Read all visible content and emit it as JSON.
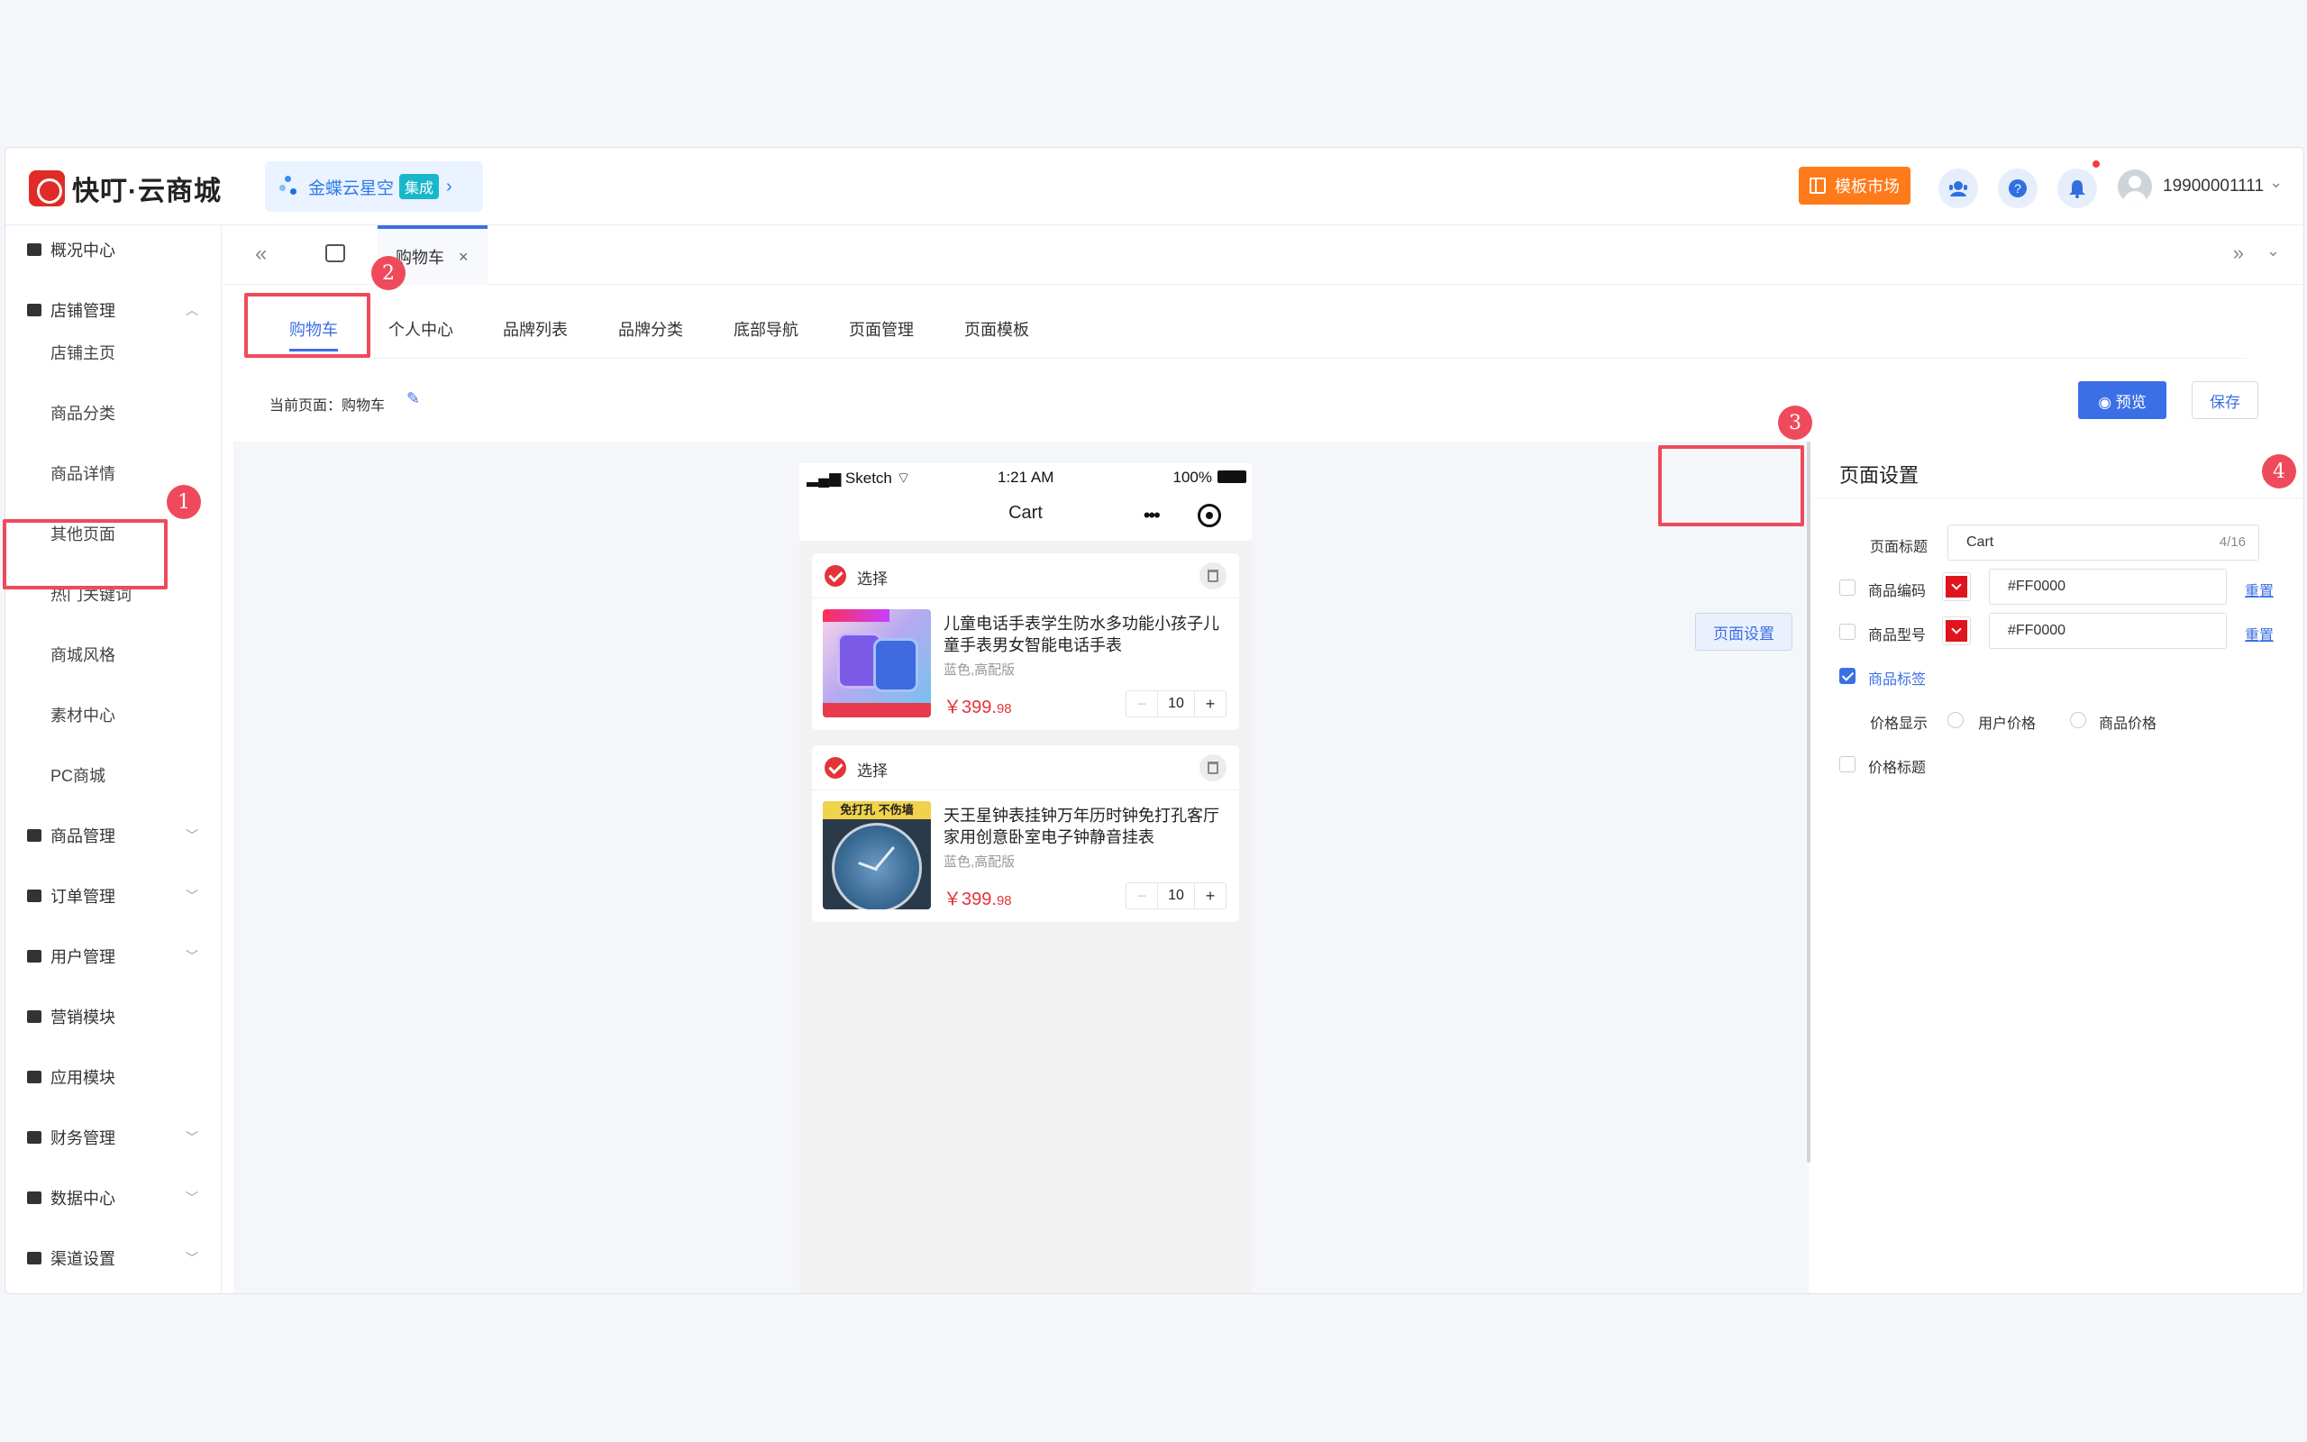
{
  "header": {
    "brand": "快叮·云商城",
    "integration": {
      "name": "金蝶云星空",
      "badge": "集成",
      "chevron": "›"
    },
    "template_market": "模板市场",
    "icons": [
      "customer-service-icon",
      "help-icon",
      "bell-icon"
    ],
    "help_glyph": "?",
    "user_phone": "19900001111",
    "user_chevron": "⌄"
  },
  "sidebar": {
    "items": [
      {
        "label": "概况中心",
        "type": "top",
        "chevron": ""
      },
      {
        "label": "店铺管理",
        "type": "top",
        "chevron": "︿"
      },
      {
        "label": "店铺主页",
        "type": "sub"
      },
      {
        "label": "商品分类",
        "type": "sub"
      },
      {
        "label": "商品详情",
        "type": "sub"
      },
      {
        "label": "其他页面",
        "type": "sub"
      },
      {
        "label": "热门关键词",
        "type": "sub"
      },
      {
        "label": "商城风格",
        "type": "sub"
      },
      {
        "label": "素材中心",
        "type": "sub"
      },
      {
        "label": "PC商城",
        "type": "sub"
      },
      {
        "label": "商品管理",
        "type": "top",
        "chevron": "﹀"
      },
      {
        "label": "订单管理",
        "type": "top",
        "chevron": "﹀"
      },
      {
        "label": "用户管理",
        "type": "top",
        "chevron": "﹀"
      },
      {
        "label": "营销模块",
        "type": "top",
        "chevron": ""
      },
      {
        "label": "应用模块",
        "type": "top",
        "chevron": ""
      },
      {
        "label": "财务管理",
        "type": "top",
        "chevron": "﹀"
      },
      {
        "label": "数据中心",
        "type": "top",
        "chevron": "﹀"
      },
      {
        "label": "渠道设置",
        "type": "top",
        "chevron": "﹀"
      }
    ]
  },
  "tabbar": {
    "collapse_glyph": "«",
    "open_tab": "购物车",
    "close_glyph": "×",
    "right_glyph": "»",
    "dropdown_glyph": "⌄"
  },
  "page_tabs": [
    {
      "label": "购物车",
      "active": true
    },
    {
      "label": "个人中心",
      "active": false
    },
    {
      "label": "品牌列表",
      "active": false
    },
    {
      "label": "品牌分类",
      "active": false
    },
    {
      "label": "底部导航",
      "active": false
    },
    {
      "label": "页面管理",
      "active": false
    },
    {
      "label": "页面模板",
      "active": false
    }
  ],
  "current_page": {
    "label": "当前页面：购物车",
    "edit_glyph": "✎",
    "preview_label": "◉ 预览",
    "save_label": "保存"
  },
  "phone": {
    "status": {
      "carrier": "▂▄▆ Sketch ⌔",
      "time": "1:21 AM",
      "battery": "100%"
    },
    "nav_title": "Cart",
    "capsule_dots": "•••",
    "cart_items": [
      {
        "select_label": "选择",
        "name": "儿童电话手表学生防水多功能小孩子儿童手表男女智能电话手表",
        "spec": "蓝色,高配版",
        "price_main": "￥399.",
        "price_decimal": "98",
        "qty": "10"
      },
      {
        "select_label": "选择",
        "name": "天王星钟表挂钟万年历时钟免打孔客厅家用创意卧室电子钟静音挂表",
        "spec": "蓝色,高配版",
        "price_main": "￥399.",
        "price_decimal": "98",
        "qty": "10",
        "image_banner": "免打孔 不伤墙"
      }
    ],
    "stepper_minus": "−",
    "stepper_plus": "+"
  },
  "page_settings_button": "页面设置",
  "settings_panel": {
    "title": "页面设置",
    "page_title_label": "页面标题",
    "page_title_value": "Cart",
    "page_title_count": "4/16",
    "code_label": "商品编码",
    "code_color": "#FF0000",
    "model_label": "商品型号",
    "model_color": "#FF0000",
    "reset_label": "重置",
    "tag_label": "商品标签",
    "price_display_label": "价格显示",
    "price_options": [
      "用户价格",
      "商品价格"
    ],
    "price_title_label": "价格标题"
  },
  "annotations": [
    "1",
    "2",
    "3",
    "4"
  ],
  "colors": {
    "primary": "#3b6fe6",
    "annotation": "#ef4a5b",
    "price": "#e5333a",
    "orange": "#ff7a1a"
  }
}
